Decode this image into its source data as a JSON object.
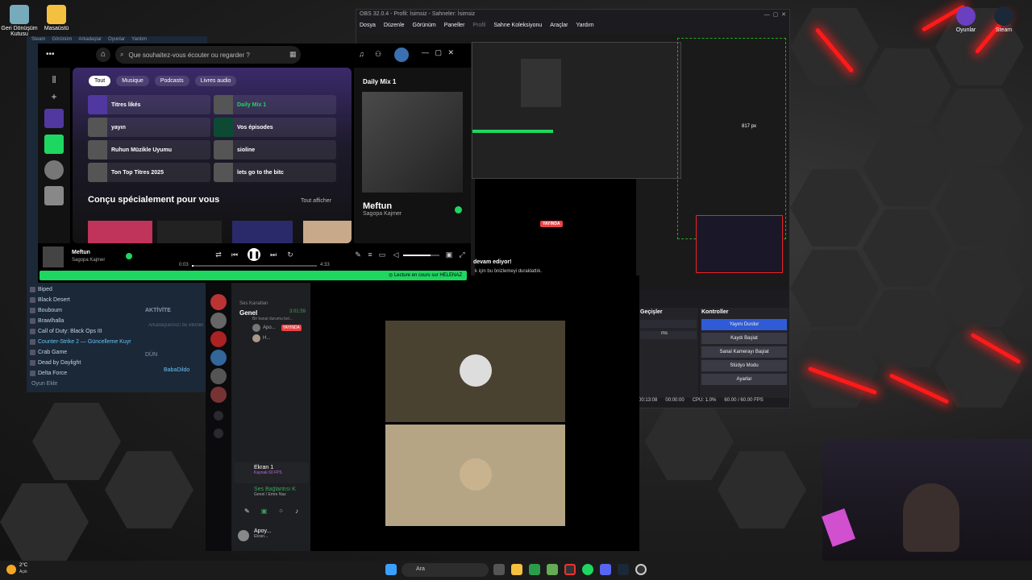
{
  "desktop": {
    "icons_left": [
      {
        "label": "Geri Dönüşüm Kutusu"
      },
      {
        "label": "Masaüstü"
      }
    ],
    "icons_right": [
      {
        "label": "Oyunlar"
      },
      {
        "label": "Steam"
      }
    ]
  },
  "obs": {
    "title": "OBS 32.0.4 - Profil: İsimsiz - Sahneler: İsimsiz",
    "menu": [
      "Dosya",
      "Düzenle",
      "Görünüm",
      "Paneller",
      "Profil",
      "Sahne Koleksiyonu",
      "Araçlar",
      "Yardım"
    ],
    "preview_label": "817 px",
    "live_badge": "YAYINDA",
    "mixer_title": "Geçişler",
    "transition_duration": "ms",
    "controls_title": "Kontroller",
    "controls": [
      "Yayını Durdur",
      "Kaydı Başlat",
      "Sanal Kamerayı Başlat",
      "Stüdyo Modu",
      "Ayarlar"
    ],
    "status": {
      "time": "00:13:08",
      "rec": "00:00:00",
      "cpu": "CPU: 1.0%",
      "fps": "60.00 / 60.00 FPS"
    }
  },
  "steam": {
    "menu": [
      "Steam",
      "Görünüm",
      "Arkadaşlar",
      "Oyunlar",
      "Yardım"
    ],
    "games": [
      "Biped",
      "Black Desert",
      "Bouboum",
      "Brawlhalla",
      "Call of Duty: Black Ops III",
      "Counter-Strike 2 — Güncelleme Kuyr",
      "Crab Game",
      "Dead by Daylight",
      "Delta Force"
    ],
    "add_game": "Oyun Ekle",
    "activity": "AKTİVİTE",
    "activity_placeholder": "Arkadaşlarınızı bu etkinlik hakkında...",
    "yesterday": "DÜN",
    "friend": "BabaDildo"
  },
  "spotify": {
    "search_placeholder": "Que souhaitez-vous écouter ou regarder ?",
    "chips": [
      "Tout",
      "Musique",
      "Podcasts",
      "Livres audio"
    ],
    "shortcuts": [
      "Titres likés",
      "Daily Mix 1",
      "yayın",
      "Vos épisodes",
      "Ruhun Müzikle Uyumu",
      "sioline",
      "Ton Top Titres 2025",
      "lets go to the bitc"
    ],
    "section_title": "Conçu spécialement pour vous",
    "show_all": "Tout afficher",
    "np_header": "Daily Mix 1",
    "np_title": "Meftun",
    "np_artist": "Sagopa Kajmer",
    "player_title": "Meftun",
    "player_artist": "Sagopa Kajmer",
    "time_current": "0:03",
    "time_total": "4:33",
    "progress": 0.011,
    "volume": 0.75,
    "device_bar": "Lecture en cours sur HELENAZ"
  },
  "discord": {
    "stream_text": "devam ediyor!",
    "stream_sub": "k için bu önizlemeyi duraklattık.",
    "voice_category": "Ses Kanalları",
    "voice_channel": "Genel",
    "voice_time": "3:01:59",
    "voice_sub": "Bir kanal durumu bel...",
    "members": [
      "Apo...",
      "H..."
    ],
    "live_badge": "YAYINDA",
    "screen_label": "Ekran 1",
    "screen_sub": "Kaynak 60 FPS",
    "voice_connected": "Ses Bağlantısı K",
    "voice_connected_sub": "Genel / Emre Naz",
    "user_name": "Apoy...",
    "user_status": "Ekran..."
  },
  "taskbar": {
    "weather_temp": "2°C",
    "weather_text": "Açık",
    "search": "Ara"
  },
  "colors": {
    "spotify_green": "#1ed760",
    "obs_blue": "#2f5bd6",
    "discord_red": "#ed4245",
    "glow_red": "#ff1a1a"
  }
}
